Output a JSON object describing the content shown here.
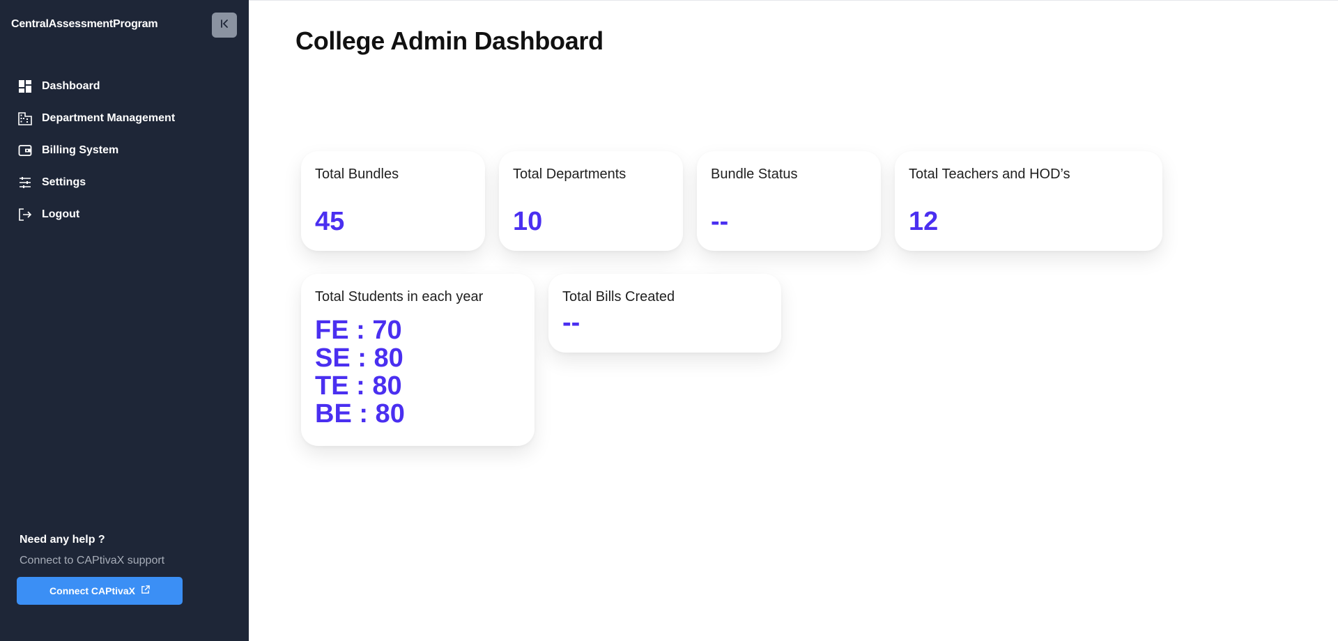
{
  "app": {
    "brand": "CentralAssessmentProgram"
  },
  "sidebar": {
    "items": [
      {
        "label": "Dashboard",
        "icon": "dashboard-icon"
      },
      {
        "label": "Department Management",
        "icon": "building-icon"
      },
      {
        "label": "Billing System",
        "icon": "wallet-icon"
      },
      {
        "label": "Settings",
        "icon": "sliders-icon"
      },
      {
        "label": "Logout",
        "icon": "logout-icon"
      }
    ],
    "help": {
      "title": "Need any help ?",
      "subtitle": "Connect to CAPtivaX support",
      "button_label": "Connect CAPtivaX"
    }
  },
  "main": {
    "title": "College Admin Dashboard",
    "cards": {
      "total_bundles": {
        "title": "Total Bundles",
        "value": "45"
      },
      "total_departments": {
        "title": "Total Departments",
        "value": "10"
      },
      "bundle_status": {
        "title": "Bundle Status",
        "value": "--"
      },
      "total_teachers": {
        "title": "Total Teachers and HOD’s",
        "value": "12"
      },
      "students": {
        "title": "Total Students in each year",
        "rows": [
          "FE : 70",
          "SE : 80",
          "TE : 80",
          "BE : 80"
        ]
      },
      "bills": {
        "title": "Total Bills Created",
        "value": "--"
      }
    }
  },
  "colors": {
    "sidebar_bg": "#1e2637",
    "accent_value": "#4a2ff0",
    "connect_button": "#3b8ff5"
  }
}
